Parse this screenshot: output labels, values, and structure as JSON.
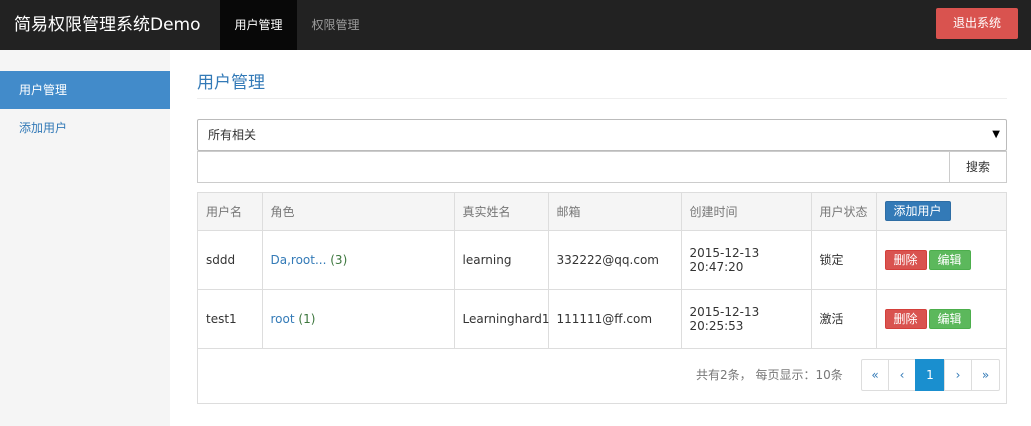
{
  "navbar": {
    "brand": "简易权限管理系统Demo",
    "tabs": [
      {
        "label": "用户管理",
        "active": true
      },
      {
        "label": "权限管理",
        "active": false
      }
    ],
    "logout_label": "退出系统"
  },
  "sidebar": {
    "items": [
      {
        "label": "用户管理",
        "active": true
      },
      {
        "label": "添加用户",
        "active": false
      }
    ]
  },
  "main": {
    "title": "用户管理",
    "filter": {
      "selected": "所有相关",
      "caret": "▼"
    },
    "search": {
      "value": "",
      "button_label": "搜索"
    },
    "table": {
      "headers": [
        "用户名",
        "角色",
        "真实姓名",
        "邮箱",
        "创建时间",
        "用户状态"
      ],
      "add_user_label": "添加用户",
      "rows": [
        {
          "username": "sddd",
          "roles": "Da,root...",
          "role_count": "(3)",
          "real_name": "learning",
          "email": "332222@qq.com",
          "created_date": "2015-12-13",
          "created_time": "20:47:20",
          "status": "锁定",
          "delete_label": "删除",
          "edit_label": "编辑"
        },
        {
          "username": "test1",
          "roles": "root",
          "role_count": "(1)",
          "real_name": "Learninghard1",
          "email": "111111@ff.com",
          "created_date": "2015-12-13",
          "created_time": "20:25:53",
          "status": "激活",
          "delete_label": "删除",
          "edit_label": "编辑"
        }
      ]
    },
    "pagination": {
      "summary": "共有2条， 每页显示：10条",
      "first": "«",
      "prev": "‹",
      "current": "1",
      "next": "›",
      "last": "»"
    }
  },
  "colors": {
    "navbar_bg": "#222222",
    "logout_button": "#d9534f",
    "sidebar_active": "#428bca",
    "link": "#337ab7",
    "delete_button": "#d9534f",
    "edit_button": "#5cb85c",
    "active_page": "#1a8fcf"
  }
}
